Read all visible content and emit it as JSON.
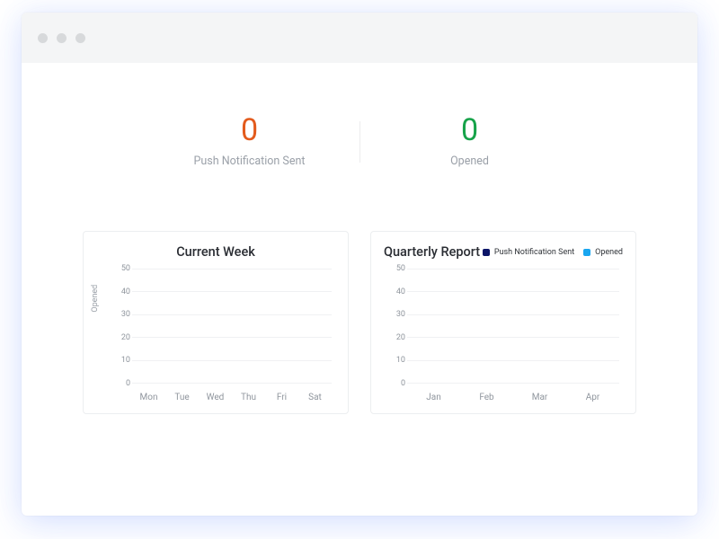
{
  "stats": {
    "sent": {
      "value": "0",
      "label": "Push Notification Sent",
      "color": "#e35b1d"
    },
    "opened": {
      "value": "0",
      "label": "Opened",
      "color": "#17a34a"
    }
  },
  "chart_data": [
    {
      "id": "current_week",
      "type": "bar",
      "title": "Current Week",
      "ylabel": "Opened",
      "ylim": [
        0,
        50
      ],
      "yticks": [
        50,
        40,
        30,
        20,
        10,
        0
      ],
      "categories": [
        "Mon",
        "Tue",
        "Wed",
        "Thu",
        "Fri",
        "Sat"
      ],
      "series": [
        {
          "name": "Opened",
          "values": [
            0,
            0,
            0,
            0,
            0,
            0
          ]
        }
      ]
    },
    {
      "id": "quarterly_report",
      "type": "bar",
      "title": "Quarterly Report",
      "ylim": [
        0,
        50
      ],
      "yticks": [
        50,
        40,
        30,
        20,
        10,
        0
      ],
      "categories": [
        "Jan",
        "Feb",
        "Mar",
        "Apr"
      ],
      "legend": [
        {
          "name": "Push Notification Sent",
          "color": "#0b1467"
        },
        {
          "name": "Opened",
          "color": "#19a6f0"
        }
      ],
      "series": [
        {
          "name": "Push Notification Sent",
          "values": [
            0,
            0,
            0,
            0
          ]
        },
        {
          "name": "Opened",
          "values": [
            0,
            0,
            0,
            0
          ]
        }
      ]
    }
  ]
}
